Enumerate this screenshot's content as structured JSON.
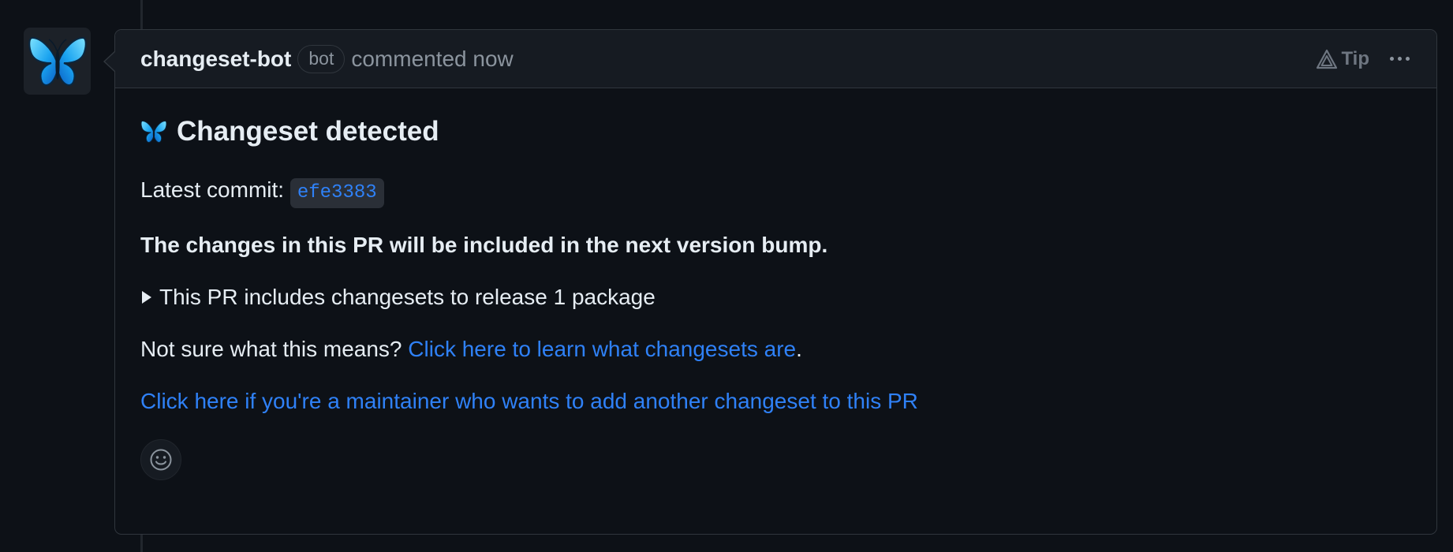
{
  "comment": {
    "author": "changeset-bot",
    "badge": "bot",
    "meta": "commented now",
    "tip_label": "Tip",
    "heading": "Changeset detected",
    "latest_commit_label": "Latest commit:",
    "commit_sha": "efe3383",
    "bump_notice": "The changes in this PR will be included in the next version bump.",
    "details_summary": "This PR includes changesets to release 1 package",
    "not_sure_text": "Not sure what this means?",
    "learn_link": "Click here to learn what changesets are",
    "learn_link_suffix": ".",
    "maintainer_link": "Click here if you're a maintainer who wants to add another changeset to this PR"
  },
  "icons": {
    "avatar": "butterfly-icon",
    "heading": "butterfly-icon",
    "tip": "warning-triangle-icon",
    "menu": "kebab-menu-icon",
    "details": "triangle-right-icon",
    "reaction": "smiley-icon"
  },
  "colors": {
    "background": "#0d1117",
    "header_bg": "#161b22",
    "border": "#30363d",
    "link": "#2f81f7",
    "text": "#e6edf3",
    "muted": "#8b949e"
  }
}
